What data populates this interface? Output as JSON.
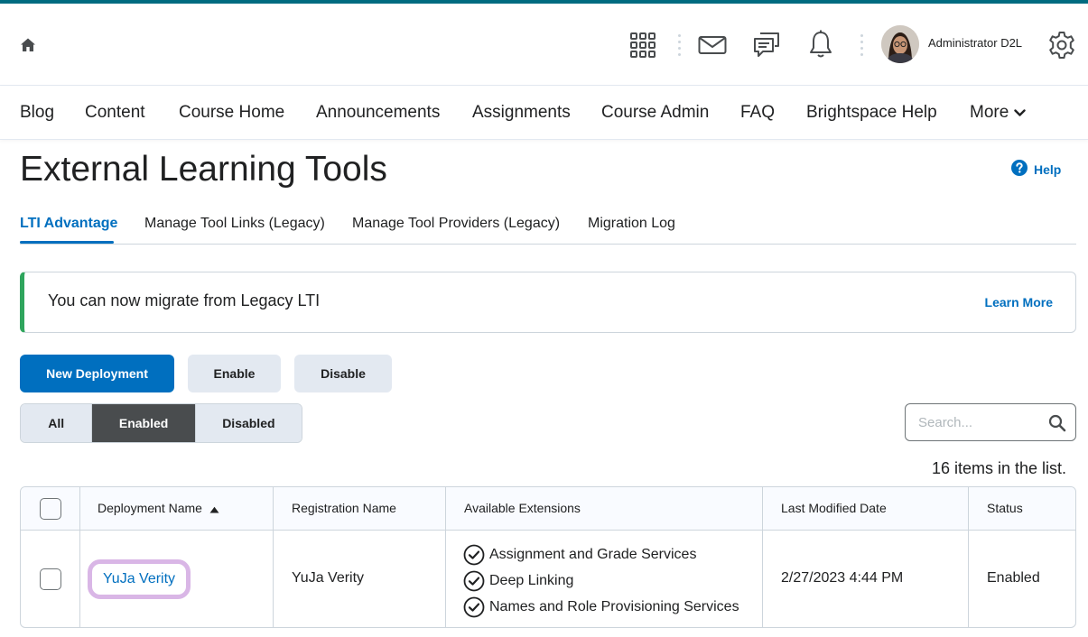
{
  "header": {
    "user_name": "Administrator D2L",
    "icons": [
      "home-icon",
      "waffle-icon",
      "mail-icon",
      "chat-icon",
      "bell-icon",
      "gear-icon"
    ]
  },
  "nav": {
    "items": [
      "Blog",
      "Content",
      "Course Home",
      "Announcements",
      "Assignments",
      "Course Admin",
      "FAQ",
      "Brightspace Help"
    ],
    "more_label": "More"
  },
  "page": {
    "title": "External Learning Tools",
    "help_label": "Help"
  },
  "tabs": [
    "LTI Advantage",
    "Manage Tool Links (Legacy)",
    "Manage Tool Providers (Legacy)",
    "Migration Log"
  ],
  "alert": {
    "text": "You can now migrate from Legacy LTI",
    "link": "Learn More"
  },
  "actions": {
    "new_deployment": "New Deployment",
    "enable": "Enable",
    "disable": "Disable"
  },
  "filters": {
    "all": "All",
    "enabled": "Enabled",
    "disabled": "Disabled",
    "selected": "Enabled"
  },
  "search": {
    "placeholder": "Search..."
  },
  "list": {
    "count_text": "16 items in the list."
  },
  "table": {
    "headers": {
      "deployment_name": "Deployment Name",
      "registration_name": "Registration Name",
      "available_extensions": "Available Extensions",
      "last_modified": "Last Modified Date",
      "status": "Status"
    },
    "sort": "Deployment Name ascending",
    "rows": [
      {
        "deployment_name": "YuJa Verity",
        "registration_name": "YuJa Verity",
        "extensions": [
          "Assignment and Grade Services",
          "Deep Linking",
          "Names and Role Provisioning Services"
        ],
        "last_modified": "2/27/2023 4:44 PM",
        "status": "Enabled"
      }
    ]
  },
  "colors": {
    "accent": "#006fbf",
    "top_bar": "#006b80",
    "alert_border": "#2fa55d",
    "highlight": "#d9b6e6"
  }
}
